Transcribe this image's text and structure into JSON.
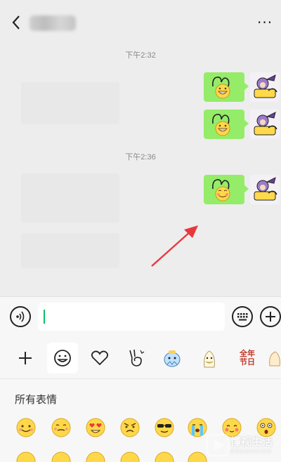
{
  "header": {
    "back_icon": "chevron-left-icon",
    "more_label": "···",
    "more_icon": "more-dots-icon"
  },
  "chat": {
    "timestamps": [
      "下午2:32",
      "下午2:36"
    ],
    "messages": [
      {
        "type": "sticker",
        "from": "me"
      },
      {
        "type": "sticker",
        "from": "me"
      },
      {
        "type": "sticker",
        "from": "me"
      }
    ]
  },
  "input": {
    "value": "",
    "voice_icon": "voice-icon",
    "keyboard_icon": "keyboard-icon",
    "plus_icon": "plus-circle-icon"
  },
  "tabs": {
    "items": [
      "add-icon",
      "smiley-icon",
      "heart-icon",
      "sticker-pack-icon",
      "sticker-pack-icon",
      "sticker-pack-icon",
      "sticker-pack-icon"
    ],
    "active_index": 1,
    "sticker_text": "全年节日"
  },
  "panel": {
    "title": "所有表情"
  },
  "watermark": {
    "title": "懂视生活",
    "sub": "DIDONGSHI.COM"
  },
  "colors": {
    "bubble": "#95ec69",
    "cursor": "#07c160",
    "arrow": "#e8383d",
    "background": "#ededed"
  }
}
